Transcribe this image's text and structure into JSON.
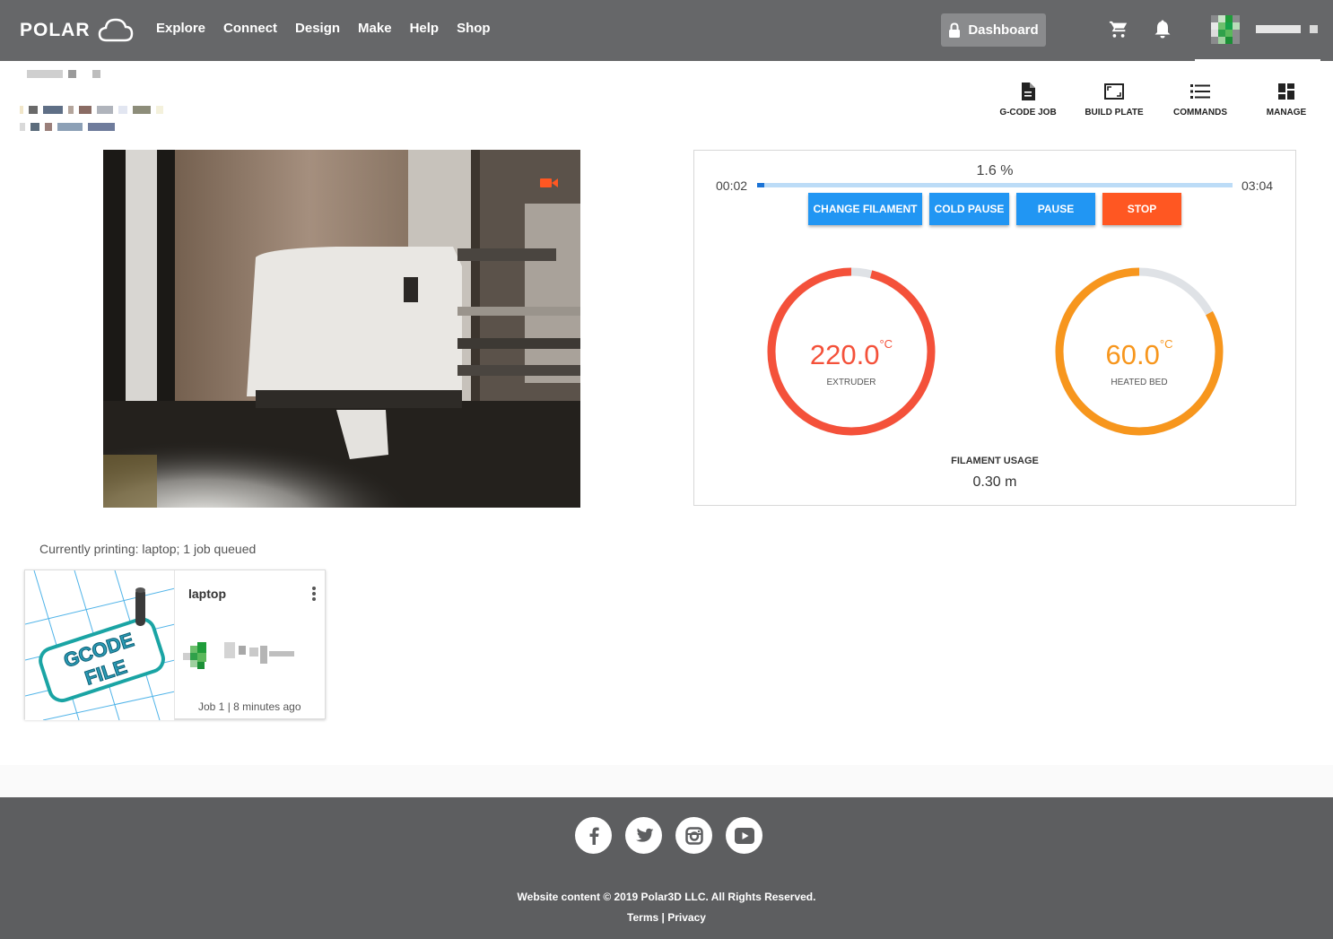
{
  "brand": {
    "logo_text": "POLAR"
  },
  "nav": {
    "links": [
      "Explore",
      "Connect",
      "Design",
      "Make",
      "Help",
      "Shop"
    ],
    "dashboard_label": "Dashboard"
  },
  "toolbar": {
    "gcode_label": "G-CODE JOB",
    "build_plate_label": "BUILD PLATE",
    "commands_label": "COMMANDS",
    "manage_label": "MANAGE"
  },
  "status": {
    "progress_percent": 1.6,
    "progress_text": "1.6 %",
    "elapsed": "00:02",
    "remaining": "03:04",
    "buttons": {
      "change_filament": "CHANGE FILAMENT",
      "cold_pause": "COLD PAUSE",
      "pause": "PAUSE",
      "stop": "STOP"
    },
    "extruder": {
      "value": "220.0",
      "unit": "°C",
      "label": "EXTRUDER",
      "fraction": 0.96,
      "color": "#f4513a"
    },
    "bed": {
      "value": "60.0",
      "unit": "°C",
      "label": "HEATED BED",
      "fraction": 0.83,
      "color": "#f7961d"
    },
    "filament_label": "FILAMENT USAGE",
    "filament_value": "0.30 m"
  },
  "queue": {
    "summary": "Currently printing: laptop; 1 job queued",
    "job": {
      "title": "laptop",
      "meta": "Job 1 | 8 minutes ago",
      "thumb_text": [
        "GCODE",
        "FILE"
      ]
    }
  },
  "footer": {
    "copyright": "Website content © 2019 Polar3D LLC. All Rights Reserved.",
    "terms": "Terms",
    "separator": "|",
    "privacy": "Privacy"
  },
  "colors": {
    "nav_bg": "#666769",
    "accent_blue": "#2196f3",
    "stop_red": "#ff5722",
    "footer_bg": "#5d5e60"
  }
}
